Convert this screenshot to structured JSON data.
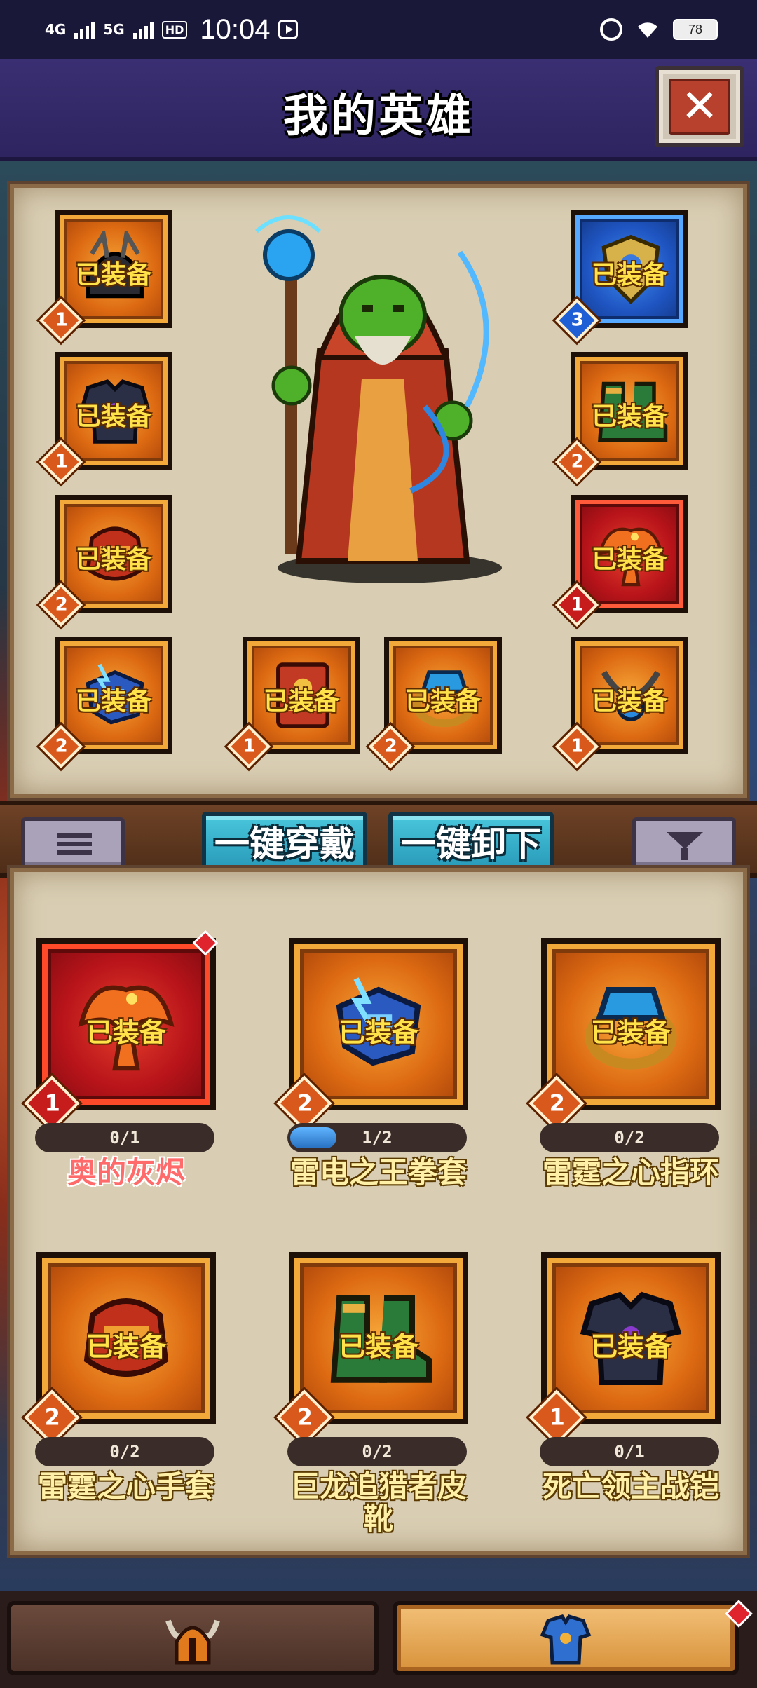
{
  "status_bar": {
    "network_1": "4G",
    "network_2": "5G",
    "hd": "HD",
    "time": "10:04",
    "battery": "78"
  },
  "header": {
    "title": "我的英雄",
    "close_icon": "close-icon"
  },
  "equip_slots": {
    "tag": "已装备",
    "items": [
      {
        "icon": "helmet-icon",
        "level": "1",
        "tier": "orange"
      },
      {
        "icon": "shield-badge-icon",
        "level": "3",
        "tier": "blue"
      },
      {
        "icon": "armor-icon",
        "level": "1",
        "tier": "orange"
      },
      {
        "icon": "boots-icon",
        "level": "2",
        "tier": "orange"
      },
      {
        "icon": "gauntlet-icon",
        "level": "2",
        "tier": "orange"
      },
      {
        "icon": "phoenix-icon",
        "level": "1",
        "tier": "red"
      },
      {
        "icon": "thunder-fist-icon",
        "level": "2",
        "tier": "orange"
      },
      {
        "icon": "card-icon",
        "level": "1",
        "tier": "orange"
      },
      {
        "icon": "ring-icon",
        "level": "2",
        "tier": "orange"
      },
      {
        "icon": "necklace-icon",
        "level": "1",
        "tier": "orange"
      }
    ]
  },
  "toolbar": {
    "list_icon": "list-icon",
    "equip_all": "一键穿戴",
    "unequip_all": "一键卸下",
    "filter_icon": "filter-icon"
  },
  "inventory": {
    "tag": "已装备",
    "items": [
      {
        "name": "奥的灰烬",
        "level": "1",
        "progress": "0/1",
        "progress_fraction": 0,
        "tier": "red",
        "icon": "phoenix-icon",
        "new": true
      },
      {
        "name": "雷电之王拳套",
        "level": "2",
        "progress": "1/2",
        "progress_fraction": 0.5,
        "tier": "orange",
        "icon": "thunder-fist-icon",
        "new": false
      },
      {
        "name": "雷霆之心指环",
        "level": "2",
        "progress": "0/2",
        "progress_fraction": 0,
        "tier": "orange",
        "icon": "ring-icon",
        "new": false
      },
      {
        "name": "雷霆之心手套",
        "level": "2",
        "progress": "0/2",
        "progress_fraction": 0,
        "tier": "orange",
        "icon": "gauntlet-icon",
        "new": false
      },
      {
        "name": "巨龙追猎者皮靴",
        "level": "2",
        "progress": "0/2",
        "progress_fraction": 0,
        "tier": "orange",
        "icon": "boots-icon",
        "new": false
      },
      {
        "name": "死亡领主战铠",
        "level": "1",
        "progress": "0/1",
        "progress_fraction": 0,
        "tier": "orange",
        "icon": "armor-icon",
        "new": false
      }
    ]
  },
  "tabbar": {
    "hero_tab_icon": "viking-helmet-icon",
    "equip_tab_icon": "armor-icon",
    "active": "equip"
  }
}
